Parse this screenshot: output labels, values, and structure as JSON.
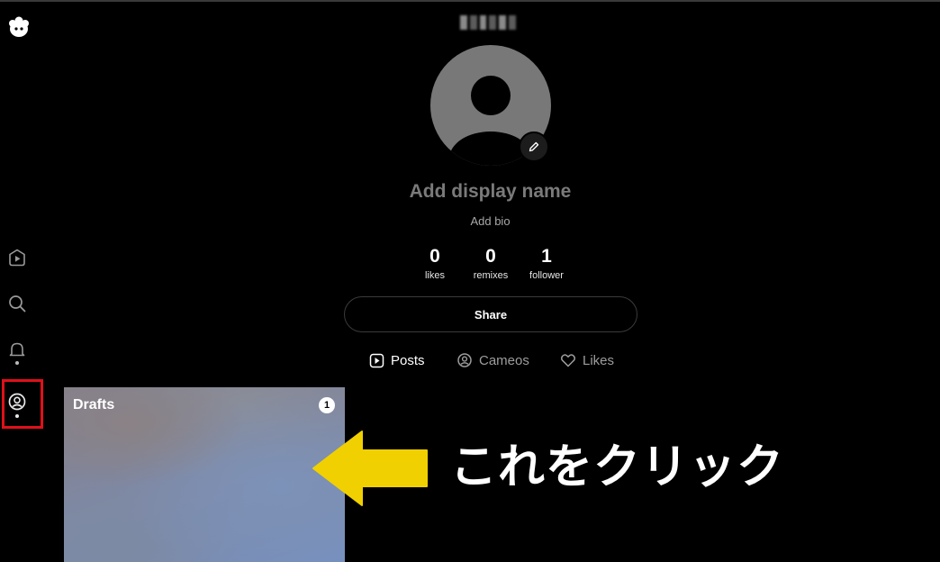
{
  "sidebar": {
    "logo_icon": "app-logo-icon",
    "items": [
      {
        "name": "feed",
        "icon": "play-icon"
      },
      {
        "name": "search",
        "icon": "search-icon"
      },
      {
        "name": "notifications",
        "icon": "bell-icon"
      },
      {
        "name": "profile",
        "icon": "profile-icon",
        "active": true
      }
    ],
    "highlight_color": "#e0101a"
  },
  "profile": {
    "display_name_placeholder": "Add display name",
    "bio_placeholder": "Add bio",
    "stats": [
      {
        "value": "0",
        "label": "likes"
      },
      {
        "value": "0",
        "label": "remixes"
      },
      {
        "value": "1",
        "label": "follower"
      }
    ],
    "share_label": "Share"
  },
  "tabs": [
    {
      "label": "Posts",
      "icon": "play-icon",
      "active": true
    },
    {
      "label": "Cameos",
      "icon": "profile-icon",
      "active": false
    },
    {
      "label": "Likes",
      "icon": "heart-icon",
      "active": false
    }
  ],
  "drafts": {
    "label": "Drafts",
    "count": "1"
  },
  "annotation": {
    "text": "これをクリック",
    "arrow_color": "#f0d000"
  }
}
